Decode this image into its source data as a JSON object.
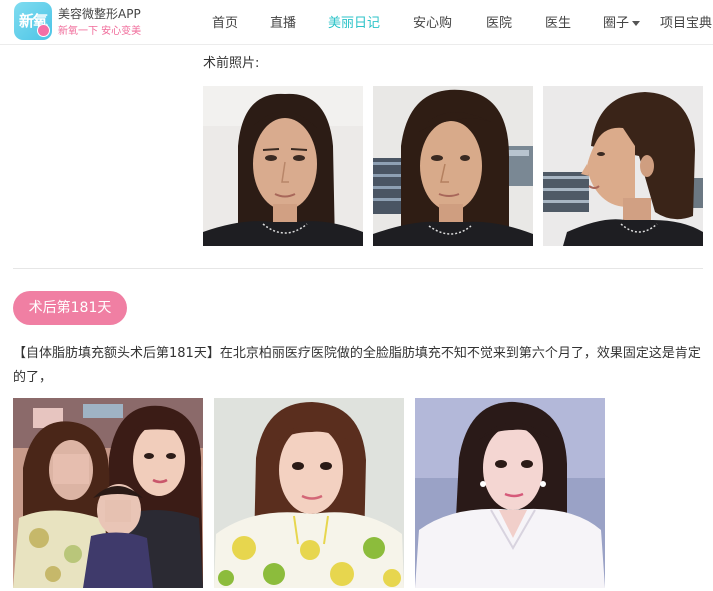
{
  "app": {
    "logo_text": "新氧",
    "name": "美容微整形APP",
    "slogan": "新氧一下  安心变美"
  },
  "nav": {
    "items": [
      {
        "label": "首页"
      },
      {
        "label": "直播"
      },
      {
        "label": "美丽日记",
        "active": true
      },
      {
        "label": "安心购"
      },
      {
        "label": "医院"
      },
      {
        "label": "医生"
      },
      {
        "label": "圈子",
        "has_dropdown": true
      },
      {
        "label": "项目宝典"
      }
    ]
  },
  "before": {
    "label": "术前照片:",
    "photos": [
      {
        "name": "before-photo-front"
      },
      {
        "name": "before-photo-three-quarter"
      },
      {
        "name": "before-photo-profile"
      }
    ]
  },
  "post": {
    "badge": "术后第181天",
    "text": "【自体脂肪填充额头术后第181天】在北京柏丽医疗医院做的全脸脂肪填充不知不觉来到第六个月了，效果固定这是肯定的了，",
    "photos": [
      {
        "name": "after-photo-group"
      },
      {
        "name": "after-photo-lemon-hoodie"
      },
      {
        "name": "after-photo-white-shirt"
      }
    ]
  },
  "colors": {
    "accent": "#2cc3c8",
    "badge": "#f07fa3",
    "logo": "#4cc4e6"
  }
}
